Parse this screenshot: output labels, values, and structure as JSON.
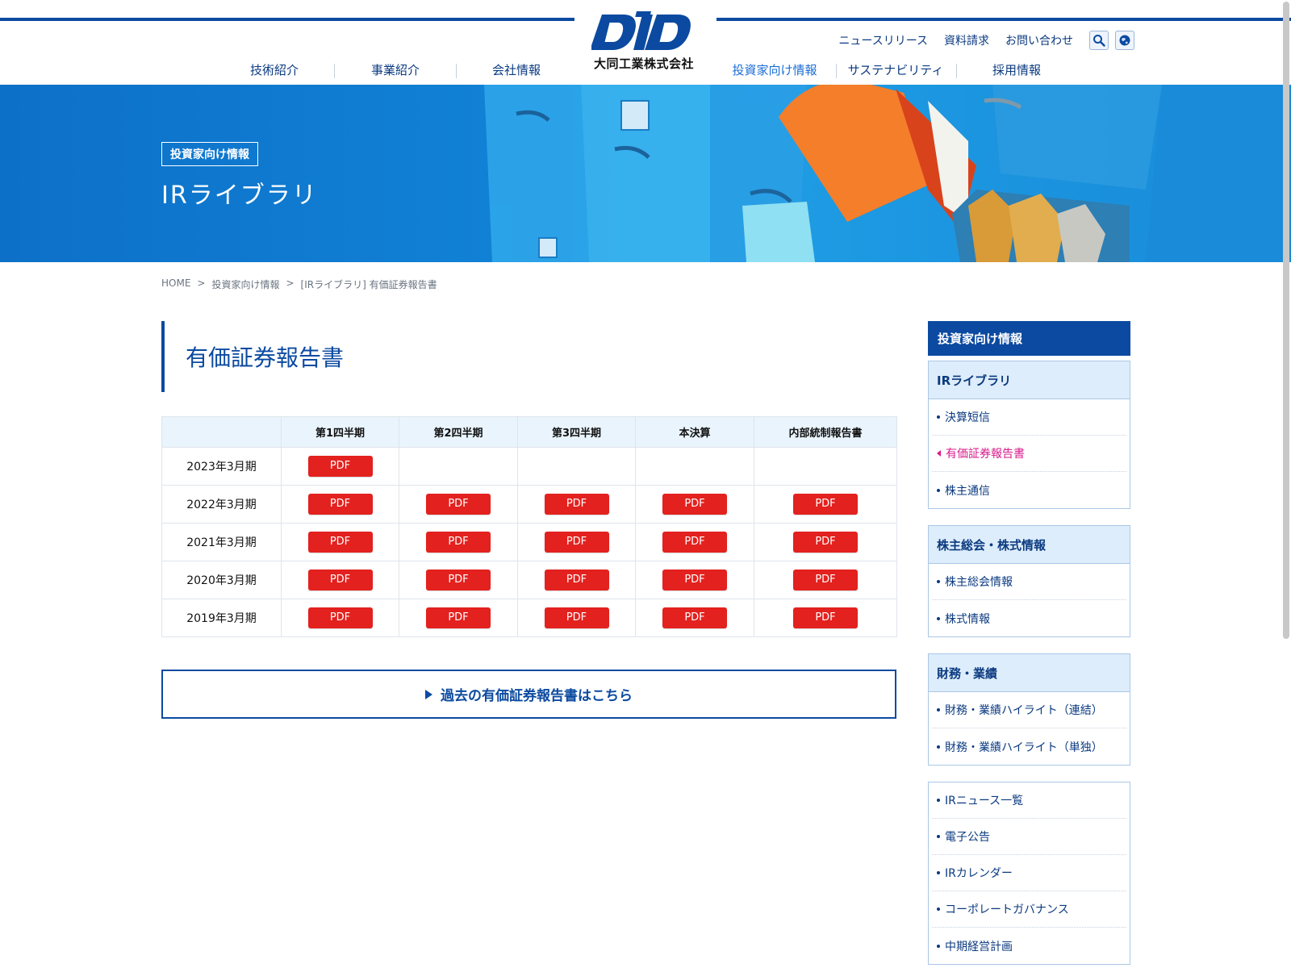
{
  "brand": {
    "logo_text": "DID",
    "company": "大同工業株式会社",
    "primary_color": "#0b4aa0",
    "pdf_color": "#e3211e",
    "accent_pink": "#d91a8b"
  },
  "utility_nav": [
    "ニュースリリース",
    "資料請求",
    "お問い合わせ"
  ],
  "global_nav": [
    "技術紹介",
    "事業紹介",
    "会社情報",
    "投資家向け情報",
    "サステナビリティ",
    "採用情報"
  ],
  "hero": {
    "tag": "投資家向け情報",
    "title": "IRライブラリ"
  },
  "breadcrumb": {
    "home": "HOME",
    "sep": ">",
    "parent": "投資家向け情報",
    "current": "[IRライブラリ] 有価証券報告書"
  },
  "page_title": "有価証券報告書",
  "table": {
    "headers": [
      "第1四半期",
      "第2四半期",
      "第3四半期",
      "本決算",
      "内部統制報告書"
    ],
    "pdf_label": "PDF",
    "rows": [
      {
        "period": "2023年3月期",
        "available": [
          true,
          false,
          false,
          false,
          false
        ]
      },
      {
        "period": "2022年3月期",
        "available": [
          true,
          true,
          true,
          true,
          true
        ]
      },
      {
        "period": "2021年3月期",
        "available": [
          true,
          true,
          true,
          true,
          true
        ]
      },
      {
        "period": "2020年3月期",
        "available": [
          true,
          true,
          true,
          true,
          true
        ]
      },
      {
        "period": "2019年3月期",
        "available": [
          true,
          true,
          true,
          true,
          true
        ]
      }
    ]
  },
  "past_link": "過去の有価証券報告書はこちら",
  "sidebar": {
    "heading": "投資家向け情報",
    "groups": [
      {
        "title": "IRライブラリ",
        "items": [
          "決算短信",
          "有価証券報告書",
          "株主通信"
        ],
        "current": "有価証券報告書"
      },
      {
        "title": "株主総会・株式情報",
        "items": [
          "株主総会情報",
          "株式情報"
        ]
      },
      {
        "title": "財務・業績",
        "items": [
          "財務・業績ハイライト（連結）",
          "財務・業績ハイライト（単独）"
        ]
      },
      {
        "title": "",
        "items": [
          "IRニュース一覧",
          "電子公告",
          "IRカレンダー",
          "コーポレートガバナンス",
          "中期経営計画"
        ]
      }
    ]
  }
}
